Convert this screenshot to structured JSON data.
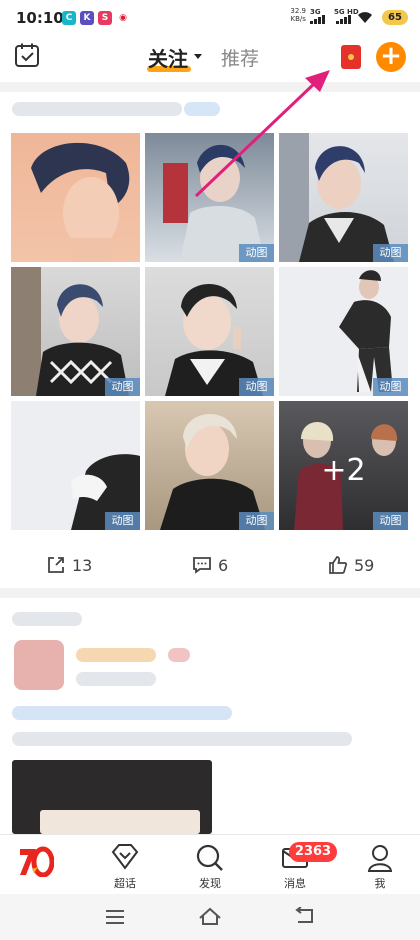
{
  "status_bar": {
    "time": "10:10",
    "net_speed": "32.9",
    "net_unit": "KB/s",
    "sig1": "3G",
    "sig2": "5G HD",
    "battery": "65"
  },
  "header": {
    "tab_follow": "关注",
    "tab_recommend": "推荐",
    "add_label": "+"
  },
  "post": {
    "badge_label": "动图",
    "more_count": "+2",
    "shares": "13",
    "comments": "6",
    "likes": "59"
  },
  "bottom_nav": {
    "chaohua": "超话",
    "discover": "发现",
    "messages": "消息",
    "me": "我",
    "message_count": "2363"
  },
  "colors": {
    "accent": "#ff8a00",
    "badge_red": "#ff3b3b",
    "arrow": "#e0207a"
  }
}
